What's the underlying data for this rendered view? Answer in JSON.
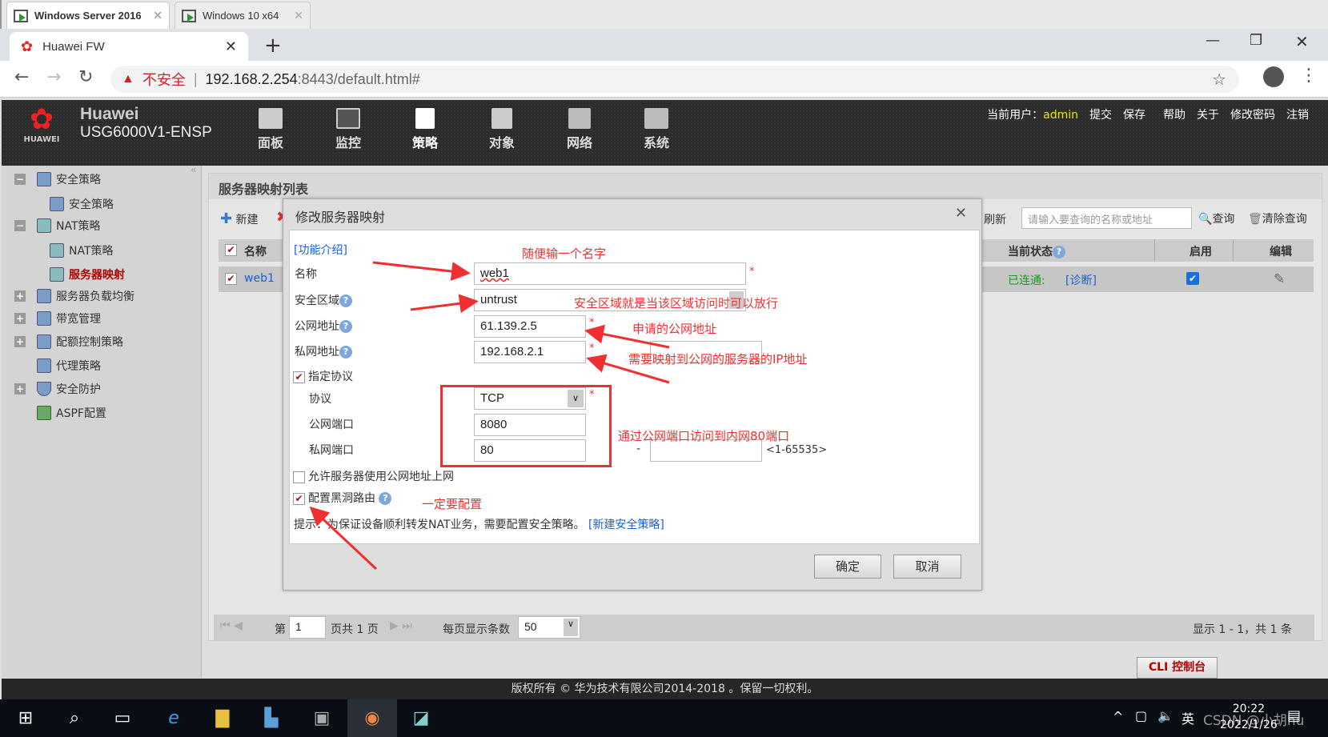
{
  "vm_tabs": [
    {
      "label": "Windows Server 2016",
      "active": true
    },
    {
      "label": "Windows 10 x64",
      "active": false
    }
  ],
  "browser": {
    "tab_title": "Huawei FW",
    "security_label": "不安全",
    "url_host": "192.168.2.254",
    "url_rest": ":8443/default.html#"
  },
  "header": {
    "brand": "Huawei",
    "model": "USG6000V1-ENSP",
    "logo_text": "HUAWEI",
    "nav": [
      {
        "label": "面板",
        "icon": "dashboard-icon"
      },
      {
        "label": "监控",
        "icon": "monitor-icon"
      },
      {
        "label": "策略",
        "icon": "policy-icon"
      },
      {
        "label": "对象",
        "icon": "object-icon"
      },
      {
        "label": "网络",
        "icon": "network-icon"
      },
      {
        "label": "系统",
        "icon": "system-icon"
      }
    ],
    "user_label": "当前用户：",
    "user": "admin",
    "links": [
      "提交",
      "保存",
      "帮助",
      "关于",
      "修改密码",
      "注销"
    ]
  },
  "sidebar": {
    "items": [
      {
        "label": "安全策略",
        "expander": "−",
        "level": 0
      },
      {
        "label": "安全策略",
        "level": 1
      },
      {
        "label": "NAT策略",
        "expander": "−",
        "level": 0
      },
      {
        "label": "NAT策略",
        "level": 1
      },
      {
        "label": "服务器映射",
        "level": 1,
        "active": true
      },
      {
        "label": "服务器负载均衡",
        "expander": "+",
        "level": 0
      },
      {
        "label": "带宽管理",
        "expander": "+",
        "level": 0
      },
      {
        "label": "配额控制策略",
        "expander": "+",
        "level": 0
      },
      {
        "label": "代理策略",
        "level": 0
      },
      {
        "label": "安全防护",
        "expander": "+",
        "level": 0
      },
      {
        "label": "ASPF配置",
        "level": 0
      }
    ]
  },
  "list": {
    "title": "服务器映射列表",
    "new": "新建",
    "refresh": "刷新",
    "search_placeholder": "请输入要查询的名称或地址",
    "query": "查询",
    "clear_query": "清除查询",
    "columns": {
      "name": "名称",
      "status": "当前状态",
      "enabled": "启用",
      "edit": "编辑"
    },
    "rows": [
      {
        "name": "web1",
        "status": "已连通:",
        "diagnose": "[诊断]",
        "enabled": true
      }
    ]
  },
  "pager": {
    "page_prefix": "第",
    "page": "1",
    "page_suffix": "页共 1 页",
    "per_page_label": "每页显示条数",
    "per_page": "50",
    "summary": "显示 1 - 1，共 1 条"
  },
  "dialog": {
    "title": "修改服务器映射",
    "intro_link": "[功能介绍]",
    "fields": {
      "name_label": "名称",
      "name": "web1",
      "zone_label": "安全区域",
      "zone": "untrust",
      "public_label": "公网地址",
      "public": "61.139.2.5",
      "private_label": "私网地址",
      "private": "192.168.2.1",
      "specify_protocol": "指定协议",
      "protocol_label": "协议",
      "protocol": "TCP",
      "public_port_label": "公网端口",
      "public_port": "8080",
      "private_port_label": "私网端口",
      "private_port": "80",
      "range_sep": "-",
      "port_range": "<1-65535>",
      "allow_public": "允许服务器使用公网地址上网",
      "blackhole": "配置黑洞路由"
    },
    "tip": "提示：为保证设备顺利转发NAT业务，需要配置安全策略。",
    "tip_link": "[新建安全策略]",
    "ok": "确定",
    "cancel": "取消"
  },
  "annotations": [
    "随便输一个名字",
    "安全区域就是当该区域访问时可以放行",
    "申请的公网地址",
    "需要映射到公网的服务器的IP地址",
    "通过公网端口访问到内网80端口",
    "一定要配置"
  ],
  "cli": "CLI 控制台",
  "copyright": "版权所有 © 华为技术有限公司2014-2018 。保留一切权利。",
  "tray": {
    "ime": "英",
    "time": "20:22",
    "date": "2022/1/26",
    "watermark": "CSDN @小胡hu"
  },
  "colors": {
    "annotation": "#f03030",
    "link": "#1a5fd6",
    "active_sidebar": "#b00000",
    "admin": "#e8e800",
    "connected": "#1a9a1a"
  }
}
